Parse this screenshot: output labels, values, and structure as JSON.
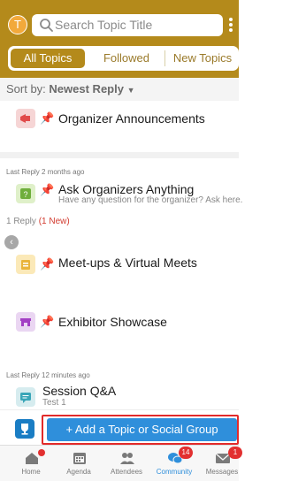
{
  "header": {
    "avatar_letter": "T",
    "search_placeholder": "Search Topic Title"
  },
  "tabs": [
    "All Topics",
    "Followed",
    "New Topics"
  ],
  "sort": {
    "prefix": "Sort by:",
    "value": "Newest Reply"
  },
  "topics": [
    {
      "title": "Organizer Announcements"
    },
    {
      "meta": "Last Reply 2 months ago",
      "title": "Ask Organizers Anything",
      "subtitle": "Have any question for the organizer? Ask here.",
      "replies": "1 Reply",
      "new": "(1 New)"
    },
    {
      "title": "Meet-ups & Virtual Meets"
    },
    {
      "title": "Exhibitor Showcase"
    },
    {
      "meta": "Last Reply 12 minutes ago",
      "title": "Session Q&A",
      "subtitle": "Test 1"
    }
  ],
  "add_button": "+ Add a Topic or Social Group",
  "tabbar": {
    "items": [
      "Home",
      "Agenda",
      "Attendees",
      "Community",
      "Messages"
    ],
    "community_badge": "14",
    "messages_badge": "1"
  },
  "colors": {
    "header": "#b48a1b",
    "primary_button": "#2f8fdb",
    "highlight_border": "#e22a2a"
  }
}
